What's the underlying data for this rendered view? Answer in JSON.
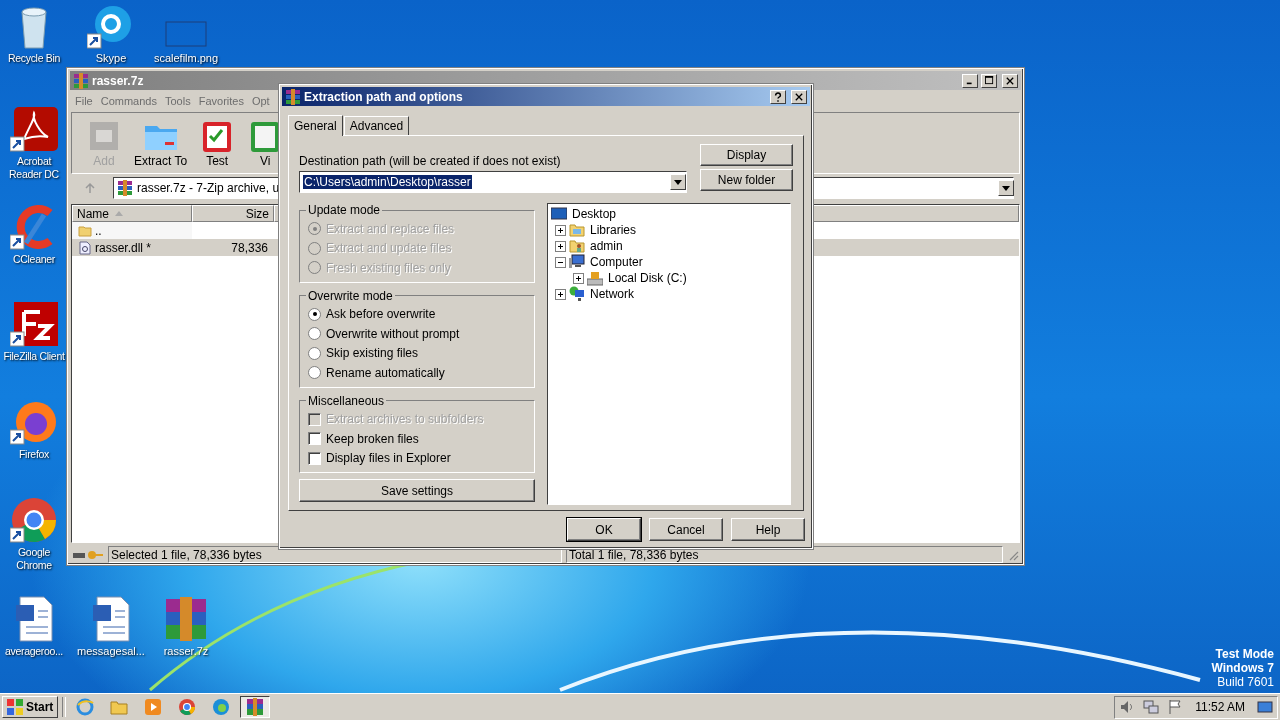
{
  "desktop_icons": [
    {
      "label": "Recycle Bin",
      "kind": "recycle",
      "shortcut": false
    },
    {
      "label": "Skype",
      "kind": "skype",
      "shortcut": true
    },
    {
      "label": "scalefilm.png",
      "kind": "image",
      "shortcut": false
    },
    {
      "label": "Acrobat Reader DC",
      "kind": "pdf",
      "shortcut": true
    },
    {
      "label": "CCleaner",
      "kind": "ccleaner",
      "shortcut": true
    },
    {
      "label": "FileZilla Client",
      "kind": "filezilla",
      "shortcut": true
    },
    {
      "label": "Firefox",
      "kind": "firefox",
      "shortcut": true
    },
    {
      "label": "Google Chrome",
      "kind": "chrome",
      "shortcut": true
    },
    {
      "label": "averageroo...",
      "kind": "word",
      "shortcut": false
    },
    {
      "label": "messagesal...",
      "kind": "word",
      "shortcut": false
    },
    {
      "label": "rasser.7z",
      "kind": "archive",
      "shortcut": false
    }
  ],
  "archive_window": {
    "title": "rasser.7z",
    "menu": [
      "File",
      "Commands",
      "Tools",
      "Favorites",
      "Opt"
    ],
    "toolbar": [
      {
        "label": "Add",
        "kind": "add",
        "disabled": true
      },
      {
        "label": "Extract To",
        "kind": "extract",
        "disabled": false
      },
      {
        "label": "Test",
        "kind": "test",
        "disabled": false
      },
      {
        "label": "Vi",
        "kind": "view",
        "disabled": false
      }
    ],
    "address": "rasser.7z - 7-Zip archive, u",
    "columns": [
      "Name",
      "Size"
    ],
    "rows": [
      {
        "name": "..",
        "kind": "folder",
        "selected": false
      },
      {
        "name": "rasser.dll *",
        "size": "78,336",
        "kind": "file",
        "selected": true
      }
    ],
    "status": [
      "Selected 1 file, 78,336 bytes",
      "Total 1 file, 78,336 bytes"
    ]
  },
  "dialog": {
    "title": "Extraction path and options",
    "tabs": [
      {
        "label": "General",
        "selected": true
      },
      {
        "label": "Advanced",
        "selected": false
      }
    ],
    "destination_label": "Destination path (will be created if does not exist)",
    "destination_value": "C:\\Users\\admin\\Desktop\\rasser",
    "side_buttons": [
      "Display",
      "New folder"
    ],
    "groups": [
      {
        "title": "Update mode",
        "kind": "radio",
        "items": [
          {
            "label": "Extract and replace files",
            "selected": true,
            "disabled": true
          },
          {
            "label": "Extract and update files",
            "selected": false,
            "disabled": true
          },
          {
            "label": "Fresh existing files only",
            "selected": false,
            "disabled": true
          }
        ]
      },
      {
        "title": "Overwrite mode",
        "kind": "radio",
        "items": [
          {
            "label": "Ask before overwrite",
            "selected": true,
            "disabled": false
          },
          {
            "label": "Overwrite without prompt",
            "selected": false,
            "disabled": false
          },
          {
            "label": "Skip existing files",
            "selected": false,
            "disabled": false
          },
          {
            "label": "Rename automatically",
            "selected": false,
            "disabled": false
          }
        ]
      },
      {
        "title": "Miscellaneous",
        "kind": "checkbox",
        "items": [
          {
            "label": "Extract archives to subfolders",
            "checked": false,
            "disabled": true
          },
          {
            "label": "Keep broken files",
            "checked": false,
            "disabled": false
          },
          {
            "label": "Display files in Explorer",
            "checked": false,
            "disabled": false
          }
        ]
      }
    ],
    "save_button": "Save settings",
    "tree": [
      {
        "label": "Desktop",
        "kind": "desktop",
        "children": [
          {
            "label": "Libraries",
            "kind": "library",
            "expanded": false
          },
          {
            "label": "admin",
            "kind": "user",
            "expanded": false
          },
          {
            "label": "Computer",
            "kind": "computer",
            "expanded": true,
            "children": [
              {
                "label": "Local Disk (C:)",
                "kind": "disk",
                "expanded": false
              }
            ]
          },
          {
            "label": "Network",
            "kind": "network",
            "expanded": false
          }
        ]
      }
    ],
    "buttons": [
      "OK",
      "Cancel",
      "Help"
    ]
  },
  "test_mode": [
    "Test Mode",
    "Windows 7",
    "Build 7601"
  ],
  "taskbar": {
    "start": "Start",
    "apps": [
      {
        "kind": "ie",
        "active": false
      },
      {
        "kind": "explorer",
        "active": false
      },
      {
        "kind": "media",
        "active": false
      },
      {
        "kind": "chrome",
        "active": false
      },
      {
        "kind": "edge",
        "active": false
      },
      {
        "kind": "archive",
        "active": true
      }
    ],
    "clock": "11:52 AM"
  }
}
